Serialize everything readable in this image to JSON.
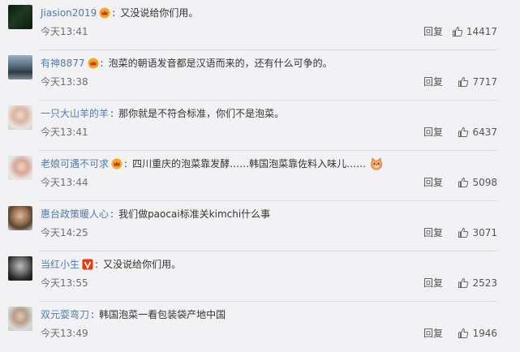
{
  "comments": [
    {
      "user": "Jiasion2019",
      "badge": "crown",
      "text": "又没说给你们用。",
      "time": "今天13:41",
      "reply": "回复",
      "likes": "14417",
      "emoji": false
    },
    {
      "user": "有神8877",
      "badge": "crown",
      "text": "泡菜的朝语发音都是汉语而来的，还有什么可争的。",
      "time": "今天13:38",
      "reply": "回复",
      "likes": "7717",
      "emoji": false
    },
    {
      "user": "一只大山羊的羊",
      "badge": "",
      "text": "那你就是不符合标准，你们不是泡菜。",
      "time": "今天13:41",
      "reply": "回复",
      "likes": "6437",
      "emoji": false
    },
    {
      "user": "老娘可遇不可求",
      "badge": "crown",
      "text": "四川重庆的泡菜靠发酵……韩国泡菜靠佐料入味儿……",
      "time": "今天13:44",
      "reply": "回复",
      "likes": "5098",
      "emoji": true
    },
    {
      "user": "惠台政策暖人心",
      "badge": "",
      "text": "我们做paocai标准关kimchi什么事",
      "time": "今天14:25",
      "reply": "回复",
      "likes": "3071",
      "emoji": false
    },
    {
      "user": "当红小生",
      "badge": "v",
      "text": "又没说给你们用。",
      "time": "今天13:55",
      "reply": "回复",
      "likes": "2523",
      "emoji": false
    },
    {
      "user": "双元耍弯刀",
      "badge": "",
      "text": "韩国泡菜一看包装袋产地中国",
      "time": "今天13:49",
      "reply": "回复",
      "likes": "1946",
      "emoji": false
    }
  ],
  "colors": {
    "background": "#f2f2f5",
    "username": "#4f7ab3",
    "crown_badge": "#f5a623",
    "v_badge": "#e8380d"
  },
  "icons": {
    "crown_badge": "crown-icon",
    "v_badge": "v-badge-icon",
    "like": "thumbs-up-icon",
    "emoji": "cat-face-emoji"
  }
}
